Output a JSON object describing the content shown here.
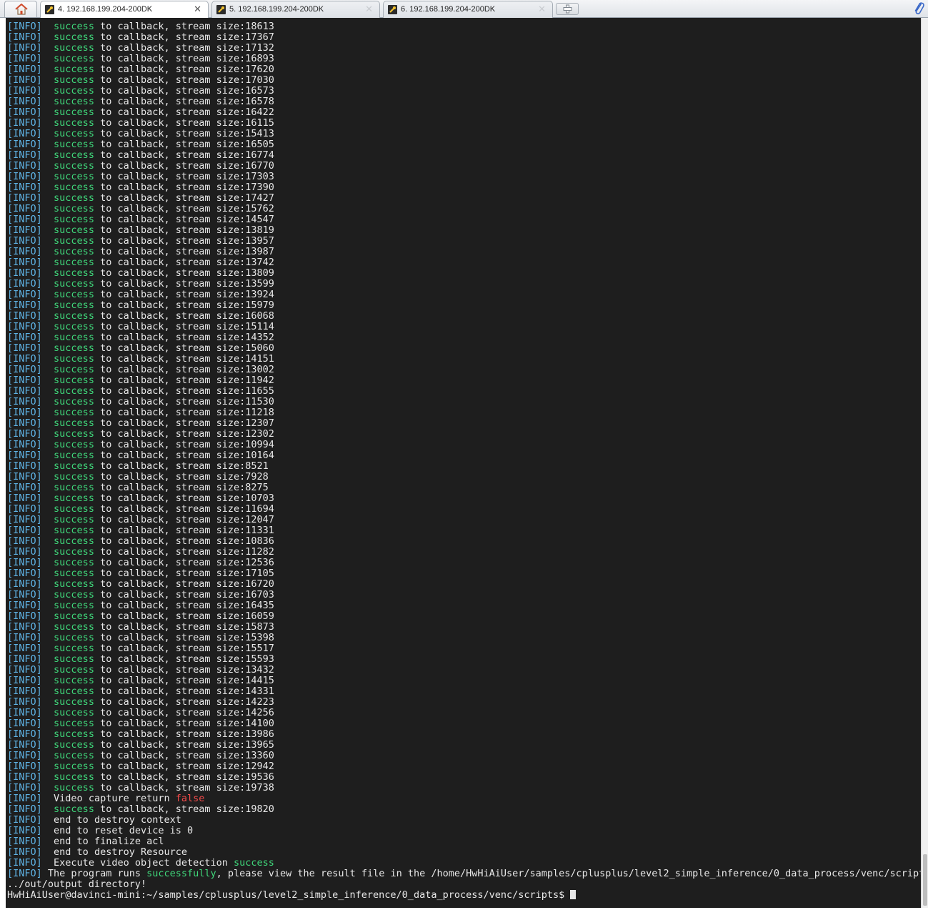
{
  "tabs": [
    {
      "label": "4. 192.168.199.204-200DK",
      "active": true
    },
    {
      "label": "5. 192.168.199.204-200DK",
      "active": false
    },
    {
      "label": "6. 192.168.199.204-200DK",
      "active": false
    }
  ],
  "icons": {
    "home": "home-icon",
    "session": "wrench-icon",
    "close": "close-icon",
    "new_tab": "plus-icon",
    "attach": "paperclip-icon"
  },
  "colors": {
    "terminal_bg": "#1e1e1e",
    "info_tag": "#5fb4e6",
    "success": "#3fd67a",
    "false": "#f04a4a",
    "text": "#e8e8e8"
  },
  "log": {
    "tag": "[INFO]",
    "success_word": "success",
    "callback_text": " to callback, stream size:",
    "stream_sizes": [
      "18613",
      "17367",
      "17132",
      "16893",
      "17620",
      "17030",
      "16573",
      "16578",
      "16422",
      "16115",
      "15413",
      "16505",
      "16774",
      "16770",
      "17303",
      "17390",
      "17427",
      "15762",
      "14547",
      "13819",
      "13957",
      "13987",
      "13742",
      "13809",
      "13599",
      "13924",
      "15979",
      "16068",
      "15114",
      "14352",
      "15060",
      "14151",
      "13002",
      "11942",
      "11655",
      "11530",
      "11218",
      "12307",
      "12302",
      "10994",
      "10164",
      "8521",
      "7928",
      "8275",
      "10703",
      "11694",
      "12047",
      "11331",
      "10836",
      "11282",
      "12536",
      "17105",
      "16720",
      "16703",
      "16435",
      "16059",
      "15873",
      "15398",
      "15517",
      "15593",
      "13432",
      "14415",
      "14331",
      "14223",
      "14256",
      "14100",
      "13986",
      "13965",
      "13360",
      "12942",
      "19536",
      "19738"
    ],
    "video_capture_text": "Video capture return ",
    "video_capture_value": "false",
    "final_stream_size": "19820",
    "end_messages": [
      "end to destroy context",
      "end to reset device is 0",
      "end to finalize acl",
      "end to destroy Resource"
    ],
    "execute_text": "Execute video object detection ",
    "execute_status": "success",
    "program_prefix": "The program runs ",
    "program_status": "successfully",
    "program_suffix": ", please view the result file in the /home/HwHiAiUser/samples/cplusplus/level2_simple_inference/0_data_process/venc/scripts",
    "output_dir_line": "../out/output directory!",
    "prompt": "HwHiAiUser@davinci-mini:~/samples/cplusplus/level2_simple_inference/0_data_process/venc/scripts$ "
  }
}
